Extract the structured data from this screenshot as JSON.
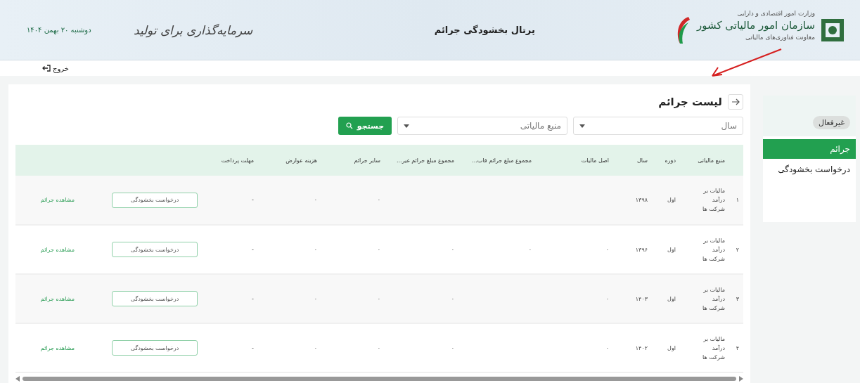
{
  "header": {
    "ministry": "وزارت امور اقتصادی و دارایی",
    "organization": "سازمان امور مالیاتی کشور",
    "deputy": "معاونت فناوری‌های مالیاتی",
    "portal_title": "پرتال بخشودگی جرائم",
    "slogan": "سرمایه‌گذاری برای تولید",
    "date": "دوشنبه ۲۰ بهمن ۱۴۰۴"
  },
  "logout": {
    "label": "خروج"
  },
  "sidebar": {
    "status_badge": "غیرفعال",
    "items": [
      {
        "label": "جرائم",
        "selected": true
      },
      {
        "label": "درخواست بخشودگی",
        "selected": false
      }
    ]
  },
  "page": {
    "title": "لیست جرائم"
  },
  "filters": [
    {
      "placeholder": "سال"
    },
    {
      "placeholder": "منبع مالیاتی"
    }
  ],
  "search_button": "جستجو",
  "table": {
    "columns": [
      "منبع مالیاتی",
      "دوره",
      "سال",
      "اصل مالیات",
      "مجموع مبلغ جرائم قاب...",
      "مجموع مبلغ جرائم غیر...",
      "سایر جرائم",
      "هزینه عوارض",
      "مهلت پرداخت"
    ],
    "rows": [
      {
        "index": "۱",
        "cells": [
          "مالیات بر درآمد شرکت ها",
          "اول",
          "۱۳۹۸",
          "",
          "",
          "",
          "٠",
          "٠",
          "-"
        ],
        "action": "درخواست بخشودگی",
        "link": "مشاهده جرائم"
      },
      {
        "index": "۲",
        "cells": [
          "مالیات بر درآمد شرکت ها",
          "اول",
          "۱۳۹۶",
          "٠",
          "٠",
          "٠",
          "٠",
          "٠",
          "-"
        ],
        "action": "درخواست بخشودگی",
        "link": "مشاهده جرائم"
      },
      {
        "index": "۳",
        "cells": [
          "مالیات بر درآمد شرکت ها",
          "اول",
          "۱۴۰۳",
          "٠",
          "",
          "٠",
          "٠",
          "٠",
          "-"
        ],
        "action": "درخواست بخشودگی",
        "link": "مشاهده جرائم"
      },
      {
        "index": "۴",
        "cells": [
          "مالیات بر درآمد شرکت ها",
          "اول",
          "۱۴۰۲",
          "٠",
          "",
          "٠",
          "٠",
          "٠",
          "-"
        ],
        "action": "درخواست بخشودگی",
        "link": "مشاهده جرائم"
      }
    ]
  }
}
